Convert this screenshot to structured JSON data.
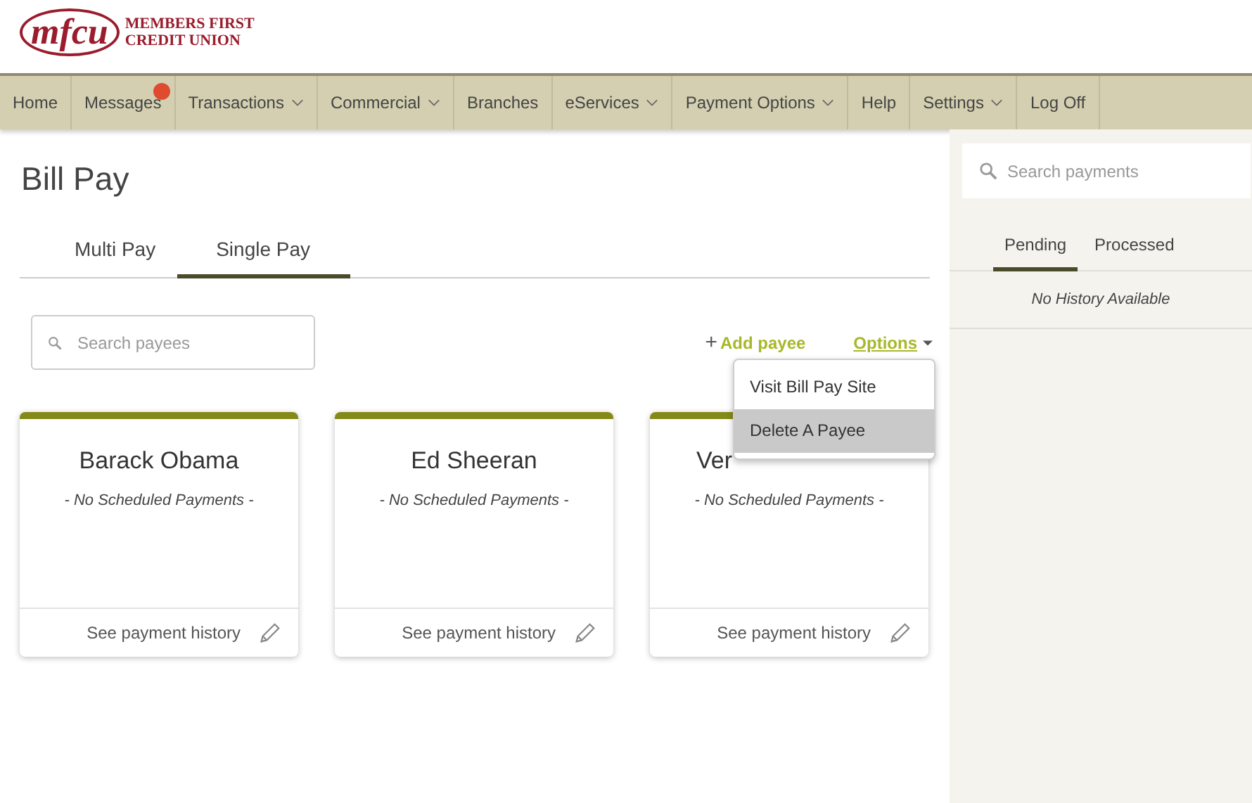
{
  "logo": {
    "mark": "mfcu",
    "line_1": "MEMBERS FIRST",
    "line_2": "CREDIT UNION"
  },
  "nav": [
    {
      "label": "Home",
      "has_menu": false,
      "alert": false
    },
    {
      "label": "Messages",
      "has_menu": false,
      "alert": true
    },
    {
      "label": "Transactions",
      "has_menu": true,
      "alert": false
    },
    {
      "label": "Commercial",
      "has_menu": true,
      "alert": false
    },
    {
      "label": "Branches",
      "has_menu": false,
      "alert": false
    },
    {
      "label": "eServices",
      "has_menu": true,
      "alert": false
    },
    {
      "label": "Payment Options",
      "has_menu": true,
      "alert": false
    },
    {
      "label": "Help",
      "has_menu": false,
      "alert": false
    },
    {
      "label": "Settings",
      "has_menu": true,
      "alert": false
    },
    {
      "label": "Log Off",
      "has_menu": false,
      "alert": false
    }
  ],
  "page_title": "Bill Pay",
  "tabs": [
    {
      "label": "Multi Pay",
      "selected": false
    },
    {
      "label": "Single Pay",
      "selected": true
    }
  ],
  "search_payees": {
    "placeholder": "Search payees"
  },
  "add_payee": {
    "icon": "+",
    "label": "Add payee"
  },
  "options": {
    "label": "Options",
    "menu": [
      {
        "label": "Visit Bill Pay Site",
        "highlighted": false
      },
      {
        "label": "Delete A Payee",
        "highlighted": true
      }
    ]
  },
  "payees": [
    {
      "name": "Barack Obama",
      "covered_by_menu": false,
      "note": "- No Scheduled Payments -",
      "link": "See payment history"
    },
    {
      "name": "Ed Sheeran",
      "covered_by_menu": false,
      "note": "- No Scheduled Payments -",
      "link": "See payment history"
    },
    {
      "name": "Ver",
      "covered_by_menu": true,
      "note": "- No Scheduled Payments -",
      "link": "See payment history"
    }
  ],
  "sidebar": {
    "search": {
      "placeholder": "Search payments"
    },
    "tabs": [
      {
        "label": "Pending",
        "selected": true
      },
      {
        "label": "Processed",
        "selected": false
      }
    ],
    "empty_message": "No History Available"
  }
}
